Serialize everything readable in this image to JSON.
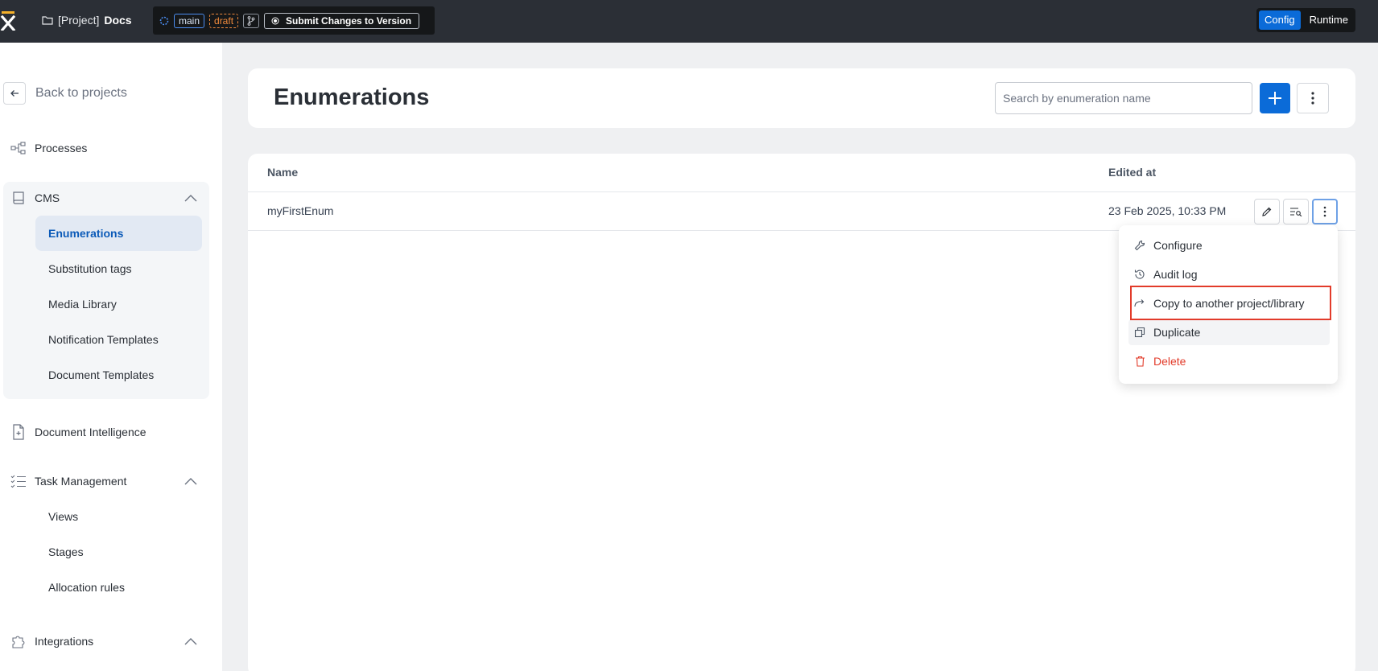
{
  "topbar": {
    "project_prefix": "[Project]",
    "project_name": "Docs",
    "branch": "main",
    "status": "draft",
    "submit_label": "Submit Changes to Version",
    "modes": [
      "Config",
      "Runtime"
    ],
    "active_mode": "Config"
  },
  "sidebar": {
    "back_label": "Back to projects",
    "items": {
      "processes": "Processes",
      "cms": "CMS",
      "document_intelligence": "Document Intelligence",
      "task_management": "Task Management",
      "integrations": "Integrations"
    },
    "cms_children": [
      "Enumerations",
      "Substitution tags",
      "Media Library",
      "Notification Templates",
      "Document Templates"
    ],
    "cms_active": "Enumerations",
    "task_children": [
      "Views",
      "Stages",
      "Allocation rules"
    ]
  },
  "main": {
    "title": "Enumerations",
    "search_placeholder": "Search by enumeration name",
    "table": {
      "columns": [
        "Name",
        "Edited at"
      ],
      "rows": [
        {
          "name": "myFirstEnum",
          "edited_at": "23 Feb 2025, 10:33 PM"
        }
      ]
    }
  },
  "context_menu": {
    "items": [
      "Configure",
      "Audit log",
      "Copy to another project/library",
      "Duplicate",
      "Delete"
    ],
    "highlighted": "Copy to another project/library",
    "hovered": "Duplicate",
    "danger_item": "Delete"
  },
  "colors": {
    "accent": "#0b6bd8",
    "danger": "#e23b2a",
    "topbar": "#2b2f36",
    "logo": "#f5b12a"
  }
}
